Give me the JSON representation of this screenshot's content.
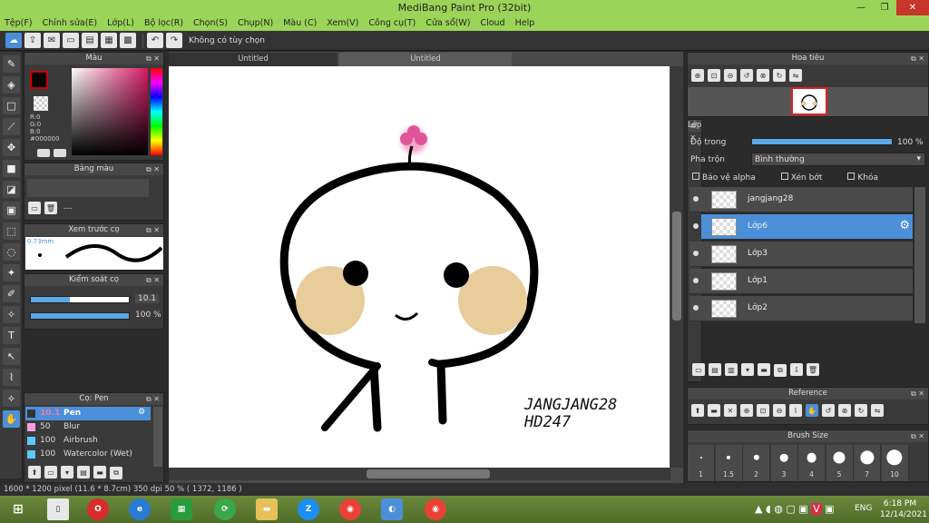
{
  "title": "MediBang Paint Pro (32bit)",
  "window_controls": {
    "minimize": "—",
    "restore": "❐",
    "close": "✕"
  },
  "menu": [
    "Tệp(F)",
    "Chỉnh sửa(E)",
    "Lớp(L)",
    "Bộ lọc(R)",
    "Chọn(S)",
    "Chụp(N)",
    "Màu (C)",
    "Xem(V)",
    "Công cụ(T)",
    "Cửa sổ(W)",
    "Cloud",
    "Help"
  ],
  "toolbar": {
    "option_label": "Không có tùy chọn"
  },
  "color_panel": {
    "title": "Màu",
    "r": "R:0",
    "g": "G:0",
    "b": "B:0",
    "hex": "#000000"
  },
  "palette_panel": {
    "title": "Bảng màu",
    "value": "---"
  },
  "brush_preview": {
    "title": "Xem trước cọ",
    "size": "0.73mm"
  },
  "brush_control": {
    "title": "Kiểm soát cọ",
    "size": "10.1",
    "opacity": "100 %",
    "size_fraction": 0.4,
    "opacity_fraction": 1.0
  },
  "brush_list": {
    "title": "Cọ: Pen",
    "items": [
      {
        "size": "10.1",
        "name": "Pen",
        "color": "#333333"
      },
      {
        "size": "50",
        "name": "Blur",
        "color": "#f0a0e0"
      },
      {
        "size": "100",
        "name": "Airbrush",
        "color": "#5bc8f5"
      },
      {
        "size": "100",
        "name": "Watercolor (Wet)",
        "color": "#5bc8f5"
      }
    ]
  },
  "tabs": [
    "Untitled",
    "Untitled"
  ],
  "canvas_text": [
    "JANGJANG28",
    "HD247"
  ],
  "navigator": {
    "title": "Hoa tiêu"
  },
  "layers_panel": {
    "title": "Lớp",
    "opacity_label": "Độ trong",
    "opacity_value": "100 %",
    "blend_label": "Pha trộn",
    "blend_value": "Bình thường",
    "protect_alpha": "Bảo vệ alpha",
    "clipping": "Xén bớt",
    "lock": "Khóa",
    "layers": [
      {
        "name": "jangjang28",
        "selected": false
      },
      {
        "name": "Lớp6",
        "selected": true
      },
      {
        "name": "Lớp3",
        "selected": false
      },
      {
        "name": "Lớp1",
        "selected": false
      },
      {
        "name": "Lớp2",
        "selected": false
      }
    ]
  },
  "reference_panel": {
    "title": "Reference"
  },
  "brush_size_panel": {
    "title": "Brush Size",
    "sizes": [
      "1",
      "1.5",
      "2",
      "3",
      "4",
      "5",
      "7",
      "10"
    ]
  },
  "status": {
    "info": "1600 * 1200 pixel   (11.6 * 8.7cm)   350 dpi   50 %   ( 1372, 1186 )"
  },
  "taskbar": {
    "lang": "ENG",
    "time": "6:18 PM",
    "date": "12/14/2021"
  },
  "colors": {
    "accent": "#4b8fd9",
    "titlebar": "#9bd458",
    "close": "#c7352b"
  }
}
